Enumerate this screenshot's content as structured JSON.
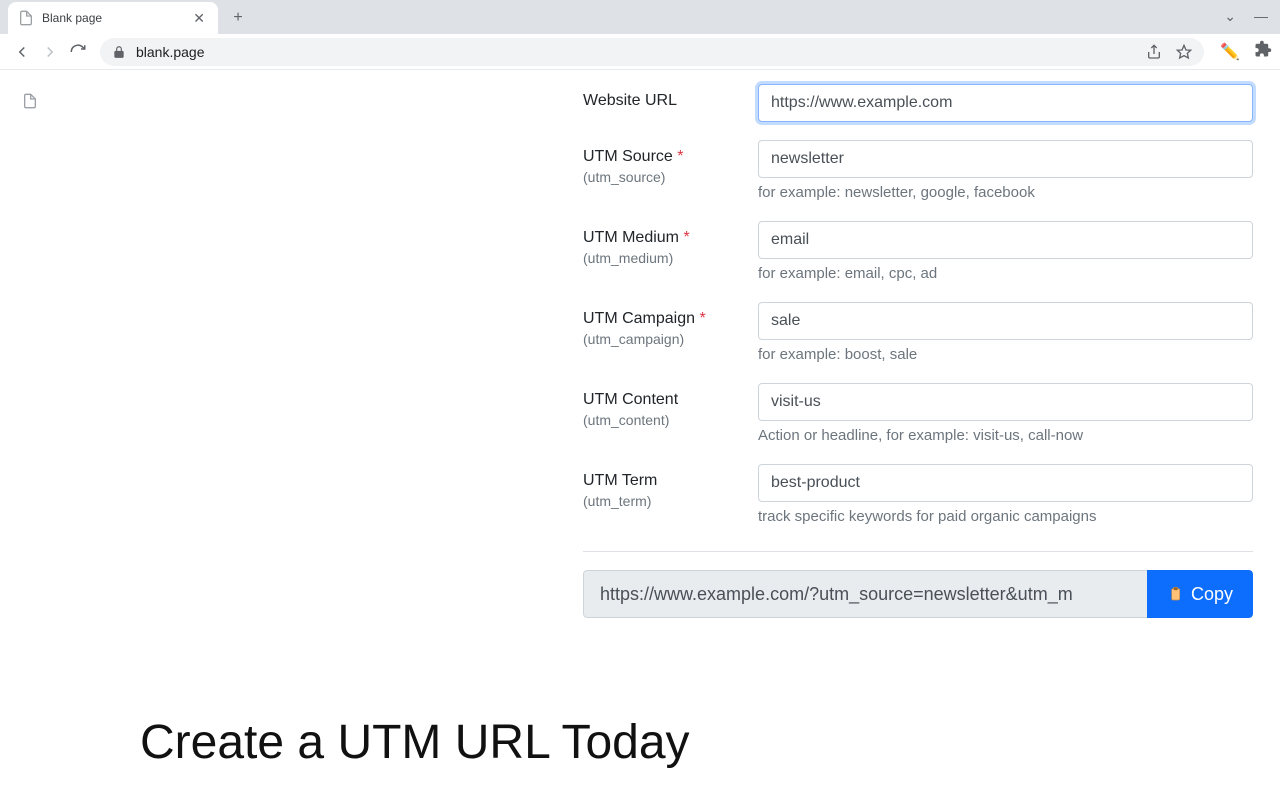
{
  "browser": {
    "tab_title": "Blank page",
    "url": "blank.page"
  },
  "form": {
    "website_url": {
      "label": "Website URL",
      "value": "https://www.example.com"
    },
    "utm_source": {
      "label": "UTM Source",
      "sublabel": "(utm_source)",
      "value": "newsletter",
      "hint": "for example: newsletter, google, facebook"
    },
    "utm_medium": {
      "label": "UTM Medium",
      "sublabel": "(utm_medium)",
      "value": "email",
      "hint": "for example: email, cpc, ad"
    },
    "utm_campaign": {
      "label": "UTM Campaign",
      "sublabel": "(utm_campaign)",
      "value": "sale",
      "hint": "for example: boost, sale"
    },
    "utm_content": {
      "label": "UTM Content",
      "sublabel": "(utm_content)",
      "value": "visit-us",
      "hint": "Action or headline, for example: visit-us, call-now"
    },
    "utm_term": {
      "label": "UTM Term",
      "sublabel": "(utm_term)",
      "value": "best-product",
      "hint": "track specific keywords for paid organic campaigns"
    },
    "result_url": "https://www.example.com/?utm_source=newsletter&utm_m",
    "copy_label": "Copy"
  },
  "headline": "Create a UTM URL Today",
  "required_marker": "*"
}
